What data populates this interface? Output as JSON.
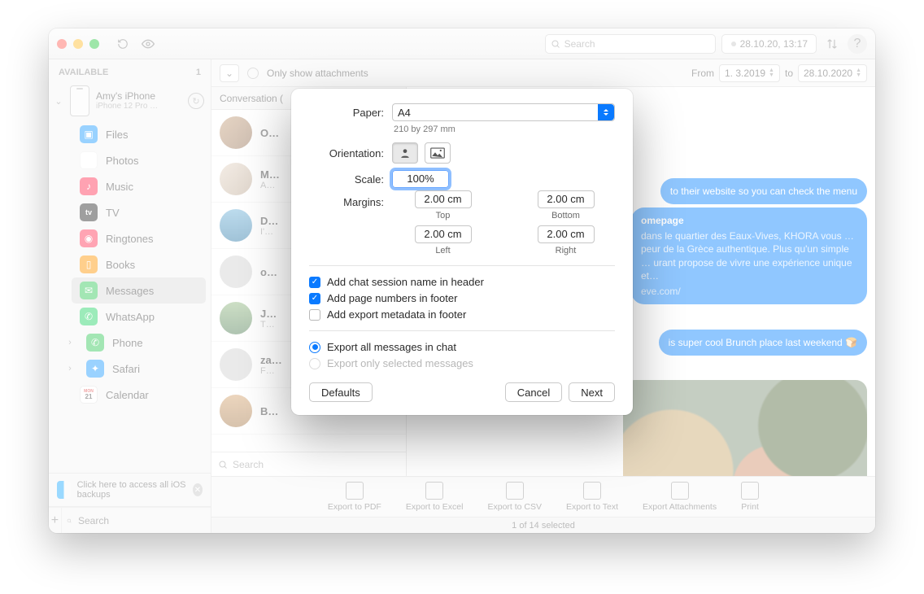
{
  "titlebar": {
    "search_placeholder": "Search",
    "date": "28.10.20, 13:17"
  },
  "sidebar": {
    "section": "AVAILABLE",
    "count": "1",
    "device_name": "Amy's iPhone",
    "device_sub": "iPhone 12 Pro …",
    "items": [
      {
        "label": "Files"
      },
      {
        "label": "Photos"
      },
      {
        "label": "Music"
      },
      {
        "label": "TV"
      },
      {
        "label": "Ringtones"
      },
      {
        "label": "Books"
      },
      {
        "label": "Messages"
      },
      {
        "label": "WhatsApp"
      },
      {
        "label": "Phone"
      },
      {
        "label": "Safari"
      },
      {
        "label": "Calendar"
      }
    ],
    "backup_note": "Click here to access all iOS backups",
    "search_placeholder": "Search"
  },
  "filterbar": {
    "only_attachments": "Only show attachments",
    "from": "From",
    "from_date": "1.  3.2019",
    "to": "to",
    "to_date": "28.10.2020"
  },
  "convo": {
    "header": "Conversation (",
    "items": [
      {
        "name": "O…",
        "sub": ""
      },
      {
        "name": "M…",
        "sub": "A…"
      },
      {
        "name": "D…",
        "sub": "I'…"
      },
      {
        "name": "o…",
        "sub": ""
      },
      {
        "name": "J…",
        "sub": "T…"
      },
      {
        "name": "za…",
        "sub": "F…"
      },
      {
        "name": "B…",
        "sub": ""
      }
    ],
    "search_placeholder": "Search"
  },
  "chat": {
    "bubble_menu": "to their website so you can check the menu",
    "bubble_homepage": "omepage",
    "bubble_desc": "dans le quartier des Eaux-Vives, KHORA vous … peur de la Grèce authentique. Plus qu'un simple … urant propose de vivre une expérience unique et…",
    "bubble_link": "eve.com/",
    "bubble_brunch": "is super cool Brunch place last weekend 🍞"
  },
  "toolbar": {
    "pdf": "Export to PDF",
    "excel": "Export to Excel",
    "csv": "Export to CSV",
    "text": "Export to Text",
    "att": "Export Attachments",
    "print": "Print"
  },
  "status": "1 of 14 selected",
  "modal": {
    "paper_label": "Paper:",
    "paper_value": "A4",
    "paper_hint": "210 by 297 mm",
    "orientation_label": "Orientation:",
    "scale_label": "Scale:",
    "scale_value": "100%",
    "margins_label": "Margins:",
    "margin_top": "2.00 cm",
    "margin_top_lbl": "Top",
    "margin_bottom": "2.00 cm",
    "margin_bottom_lbl": "Bottom",
    "margin_left": "2.00 cm",
    "margin_left_lbl": "Left",
    "margin_right": "2.00 cm",
    "margin_right_lbl": "Right",
    "chk_header": "Add chat session name in header",
    "chk_pagenum": "Add page numbers in footer",
    "chk_meta": "Add export metadata in footer",
    "radio_all": "Export all messages in chat",
    "radio_sel": "Export only selected messages",
    "defaults": "Defaults",
    "cancel": "Cancel",
    "next": "Next"
  }
}
